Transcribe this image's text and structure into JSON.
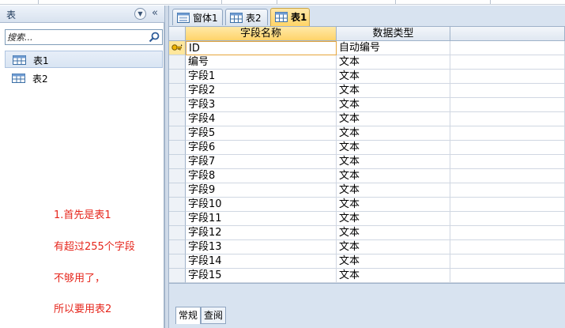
{
  "nav": {
    "title": "表",
    "search_placeholder": "搜索...",
    "items": [
      {
        "label": "表1"
      },
      {
        "label": "表2"
      }
    ]
  },
  "annotation": {
    "lines": [
      "1.首先是表1",
      "有超过255个字段",
      "不够用了，",
      "所以要用表2"
    ]
  },
  "tabs": [
    {
      "label": "窗体1",
      "icon": "form-icon"
    },
    {
      "label": "表2",
      "icon": "table-icon"
    },
    {
      "label": "表1",
      "icon": "table-icon",
      "active": true
    }
  ],
  "datasheet": {
    "columns": [
      "字段名称",
      "数据类型",
      ""
    ],
    "rows": [
      {
        "name": "ID",
        "type": "自动编号",
        "primary_key": true
      },
      {
        "name": "编号",
        "type": "文本"
      },
      {
        "name": "字段1",
        "type": "文本"
      },
      {
        "name": "字段2",
        "type": "文本"
      },
      {
        "name": "字段3",
        "type": "文本"
      },
      {
        "name": "字段4",
        "type": "文本"
      },
      {
        "name": "字段5",
        "type": "文本"
      },
      {
        "name": "字段6",
        "type": "文本"
      },
      {
        "name": "字段7",
        "type": "文本"
      },
      {
        "name": "字段8",
        "type": "文本"
      },
      {
        "name": "字段9",
        "type": "文本"
      },
      {
        "name": "字段10",
        "type": "文本"
      },
      {
        "name": "字段11",
        "type": "文本"
      },
      {
        "name": "字段12",
        "type": "文本"
      },
      {
        "name": "字段13",
        "type": "文本"
      },
      {
        "name": "字段14",
        "type": "文本"
      },
      {
        "name": "字段15",
        "type": "文本"
      }
    ]
  },
  "props_tabs": [
    "常规",
    "查阅"
  ],
  "colors": {
    "annotation": "#e6271d",
    "active_tab": "#ffd466",
    "accent_border": "#9fb2c9"
  }
}
